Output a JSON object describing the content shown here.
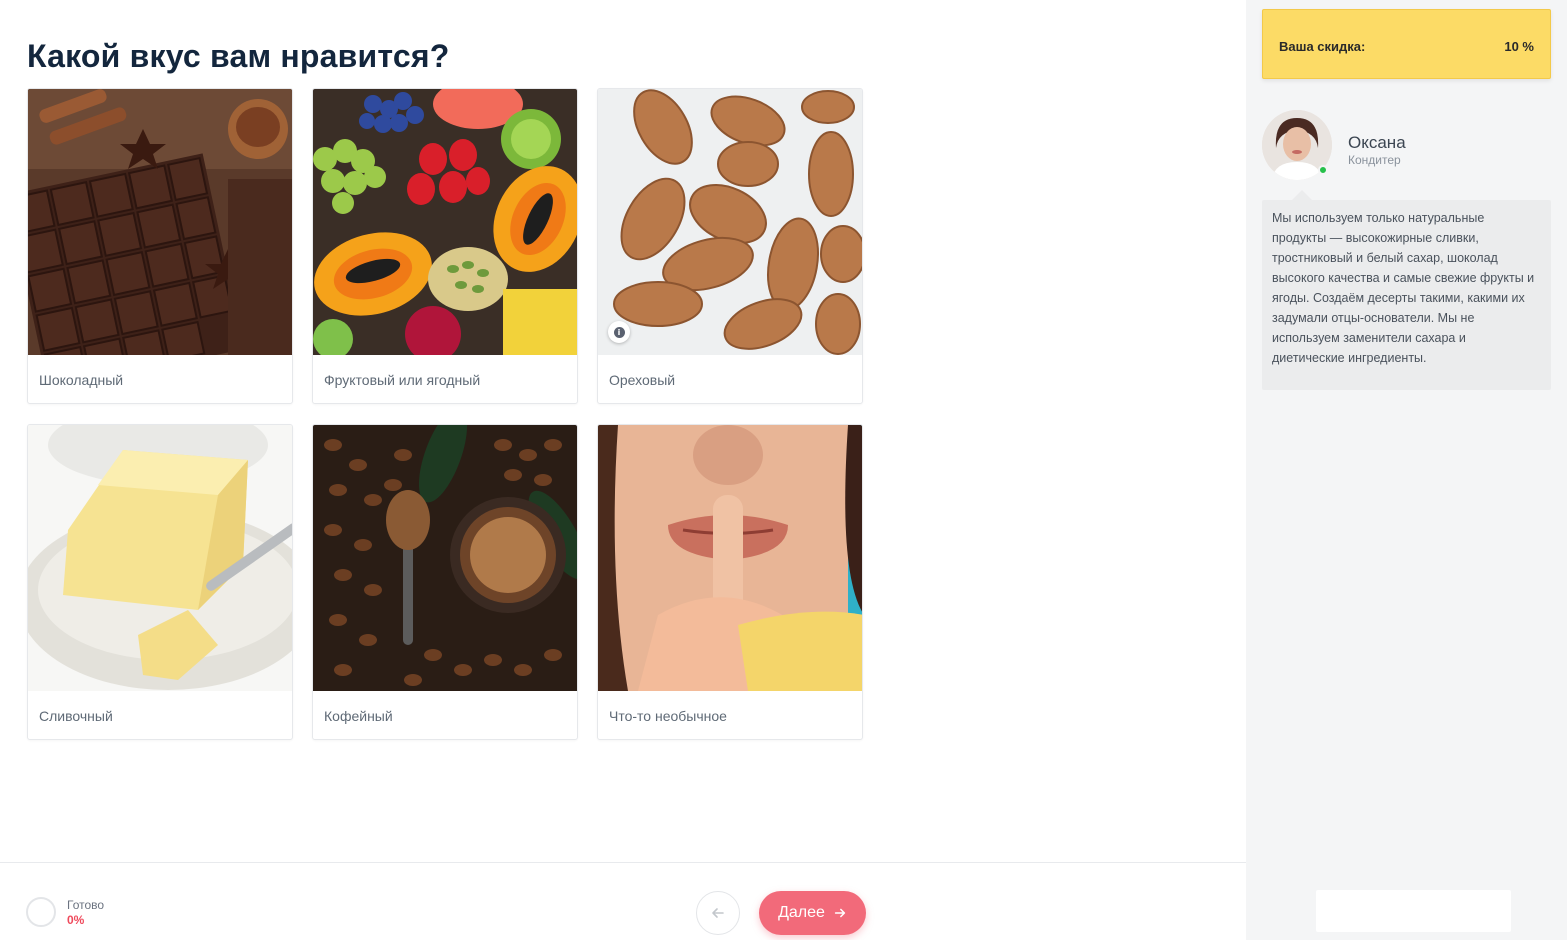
{
  "question": {
    "title": "Какой вкус вам нравится?"
  },
  "options": [
    {
      "label": "Шоколадный",
      "image": "chocolate"
    },
    {
      "label": "Фруктовый или ягодный",
      "image": "fruits-berries"
    },
    {
      "label": "Ореховый",
      "image": "almonds"
    },
    {
      "label": "Сливочный",
      "image": "butter"
    },
    {
      "label": "Кофейный",
      "image": "coffee-beans"
    },
    {
      "label": "Что-то необычное",
      "image": "secret-gesture"
    }
  ],
  "info_icon": {
    "glyph": "i"
  },
  "footer": {
    "progress_label": "Готово",
    "progress_value": "0%",
    "progress_fraction": 0,
    "back_icon": "arrow-left-icon",
    "next_label": "Далее",
    "next_icon": "arrow-right-icon",
    "accent_color": "#f26a7a"
  },
  "sidebar": {
    "discount_label": "Ваша скидка:",
    "discount_value": "10 %",
    "discount_color": "#fcdb66",
    "manager_name": "Оксана",
    "manager_role": "Кондитер",
    "status": "online",
    "message": "Мы используем только натуральные продукты — высокожирные сливки, тростниковый и белый сахар, шоколад высокого качества и самые свежие фрукты и ягоды. Создаём десерты такими, какими их задумали отцы-основатели. Мы не используем заменители сахара и диетические ингредиенты."
  }
}
